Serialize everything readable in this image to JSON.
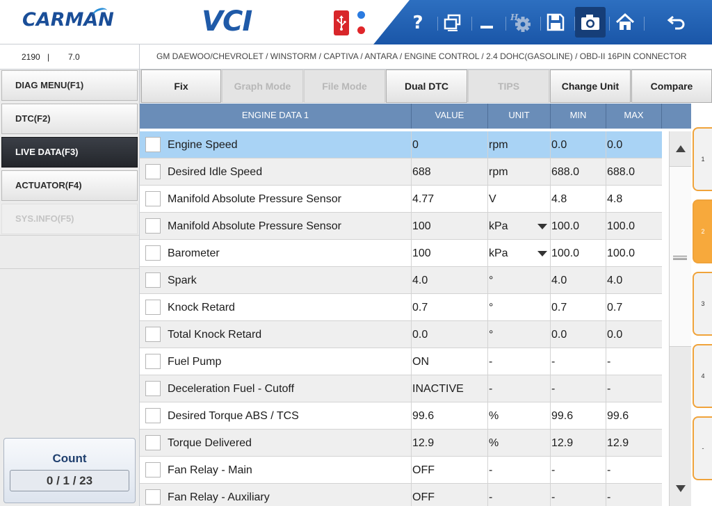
{
  "header": {
    "logo_text": "CARMAN",
    "app_title": "VCI",
    "usb_icon": "usb-icon",
    "status_leds": [
      "#2b7be0",
      "#e0262a"
    ],
    "toolbar": [
      {
        "id": "help",
        "icon": "help-icon"
      },
      {
        "id": "window",
        "icon": "restore-window-icon"
      },
      {
        "id": "minimize",
        "icon": "minimize-icon"
      },
      {
        "id": "settings",
        "icon": "settings-gear-icon"
      },
      {
        "id": "save",
        "icon": "save-icon"
      },
      {
        "id": "capture",
        "icon": "camera-icon"
      },
      {
        "id": "home",
        "icon": "home-icon"
      },
      {
        "id": "back",
        "icon": "back-arrow-icon"
      }
    ],
    "accent_color": "#1a56a8"
  },
  "infobar": {
    "code": "2190",
    "separator": "|",
    "version": "7.0",
    "vehicle_path": "GM DAEWOO/CHEVROLET / WINSTORM / CAPTIVA / ANTARA / ENGINE CONTROL / 2.4 DOHC(GASOLINE) / OBD-II 16PIN CONNECTOR"
  },
  "sidebar": {
    "items": [
      {
        "label": "DIAG MENU(F1)",
        "state": "normal"
      },
      {
        "label": "DTC(F2)",
        "state": "normal"
      },
      {
        "label": "LIVE DATA(F3)",
        "state": "active"
      },
      {
        "label": "ACTUATOR(F4)",
        "state": "normal"
      },
      {
        "label": "SYS.INFO(F5)",
        "state": "disabled"
      }
    ],
    "count": {
      "title": "Count",
      "value": "0 / 1 / 23"
    }
  },
  "function_buttons": [
    {
      "label": "Fix",
      "enabled": true
    },
    {
      "label": "Graph Mode",
      "enabled": false
    },
    {
      "label": "File Mode",
      "enabled": false
    },
    {
      "label": "Dual DTC",
      "enabled": true
    },
    {
      "label": "TIPS",
      "enabled": false
    },
    {
      "label": "Change Unit",
      "enabled": true
    },
    {
      "label": "Compare",
      "enabled": true
    }
  ],
  "table": {
    "columns": [
      "ENGINE DATA 1",
      "VALUE",
      "UNIT",
      "MIN",
      "MAX"
    ],
    "rows": [
      {
        "name": "Engine Speed",
        "value": "0",
        "unit": "rpm",
        "min": "0.0",
        "max": "0.0",
        "selected": true,
        "dropdown": false
      },
      {
        "name": "Desired Idle Speed",
        "value": "688",
        "unit": "rpm",
        "min": "688.0",
        "max": "688.0",
        "selected": false,
        "dropdown": false
      },
      {
        "name": "Manifold Absolute Pressure Sensor",
        "value": "4.77",
        "unit": "V",
        "min": "4.8",
        "max": "4.8",
        "selected": false,
        "dropdown": false
      },
      {
        "name": "Manifold Absolute Pressure Sensor",
        "value": "100",
        "unit": "kPa",
        "min": "100.0",
        "max": "100.0",
        "selected": false,
        "dropdown": true
      },
      {
        "name": "Barometer",
        "value": "100",
        "unit": "kPa",
        "min": "100.0",
        "max": "100.0",
        "selected": false,
        "dropdown": true
      },
      {
        "name": "Spark",
        "value": "4.0",
        "unit": "°",
        "min": "4.0",
        "max": "4.0",
        "selected": false,
        "dropdown": false
      },
      {
        "name": "Knock Retard",
        "value": "0.7",
        "unit": "°",
        "min": "0.7",
        "max": "0.7",
        "selected": false,
        "dropdown": false
      },
      {
        "name": "Total Knock Retard",
        "value": "0.0",
        "unit": "°",
        "min": "0.0",
        "max": "0.0",
        "selected": false,
        "dropdown": false
      },
      {
        "name": "Fuel Pump",
        "value": "ON",
        "unit": "-",
        "min": "-",
        "max": "-",
        "selected": false,
        "dropdown": false
      },
      {
        "name": "Deceleration Fuel - Cutoff",
        "value": "INACTIVE",
        "unit": "-",
        "min": "-",
        "max": "-",
        "selected": false,
        "dropdown": false
      },
      {
        "name": "Desired Torque ABS / TCS",
        "value": "99.6",
        "unit": "%",
        "min": "99.6",
        "max": "99.6",
        "selected": false,
        "dropdown": false
      },
      {
        "name": "Torque Delivered",
        "value": "12.9",
        "unit": "%",
        "min": "12.9",
        "max": "12.9",
        "selected": false,
        "dropdown": false
      },
      {
        "name": "Fan Relay - Main",
        "value": "OFF",
        "unit": "-",
        "min": "-",
        "max": "-",
        "selected": false,
        "dropdown": false
      },
      {
        "name": "Fan Relay - Auxiliary",
        "value": "OFF",
        "unit": "-",
        "min": "-",
        "max": "-",
        "selected": false,
        "dropdown": false
      }
    ]
  },
  "page_tabs": [
    {
      "label": "1",
      "active": false
    },
    {
      "label": "2",
      "active": true
    },
    {
      "label": "3",
      "active": false
    },
    {
      "label": "4",
      "active": false
    },
    {
      "label": "-",
      "active": false
    }
  ],
  "colors": {
    "header_blue": "#6a8db8",
    "selected_row": "#a9d3f5",
    "tab_orange": "#f7a93c"
  }
}
